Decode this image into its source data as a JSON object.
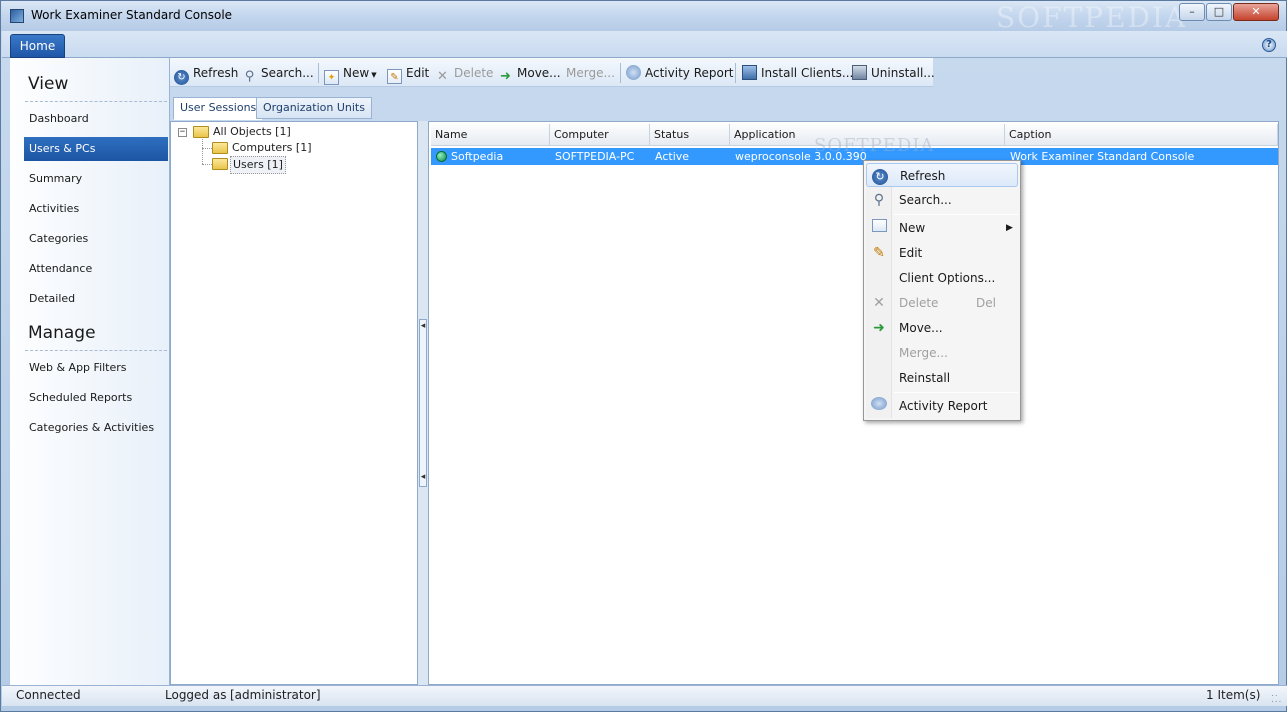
{
  "window": {
    "title": "Work Examiner Standard Console",
    "watermark": "SOFTPEDIA",
    "controls": {
      "minimize": "–",
      "maximize": "□",
      "close": "✕"
    }
  },
  "ribbon": {
    "home_tab": "Home",
    "help": "?"
  },
  "nav": {
    "view_header": "View",
    "view_items": [
      "Dashboard",
      "Users & PCs",
      "Summary",
      "Activities",
      "Categories",
      "Attendance",
      "Detailed"
    ],
    "manage_header": "Manage",
    "manage_items": [
      "Web & App Filters",
      "Scheduled Reports",
      "Categories & Activities"
    ],
    "active_item": "Users & PCs"
  },
  "toolbar": {
    "refresh": "Refresh",
    "search": "Search...",
    "new": "New",
    "edit": "Edit",
    "delete": "Delete",
    "move": "Move...",
    "merge": "Merge...",
    "activity_report": "Activity Report",
    "install_clients": "Install Clients...",
    "uninstall": "Uninstall..."
  },
  "subtabs": {
    "user_sessions": "User Sessions",
    "organization_units": "Organization Units"
  },
  "tree": {
    "expander": "−",
    "root": "All Objects [1]",
    "children": [
      "Computers [1]",
      "Users [1]"
    ]
  },
  "grid": {
    "columns": [
      "Name",
      "Computer",
      "Status",
      "Application",
      "Caption"
    ],
    "rows": [
      {
        "name": "Softpedia",
        "computer": "SOFTPEDIA-PC",
        "status": "Active",
        "application": "weproconsole 3.0.0.390",
        "caption": "Work Examiner Standard Console"
      }
    ],
    "watermark": "SOFTPEDIA"
  },
  "context_menu": {
    "refresh": "Refresh",
    "search": "Search...",
    "new": "New",
    "edit": "Edit",
    "client_options": "Client Options...",
    "delete": "Delete",
    "delete_shortcut": "Del",
    "move": "Move...",
    "merge": "Merge...",
    "reinstall": "Reinstall",
    "activity_report": "Activity Report",
    "submenu_arrow": "▶"
  },
  "statusbar": {
    "connection": "Connected",
    "logged_as_label": "Logged as",
    "user": "[administrator]",
    "items": "1 Item(s)"
  },
  "colors": {
    "accent": "#1c55a3",
    "selection": "#3399ff",
    "active_status": "#0e8a4a"
  }
}
